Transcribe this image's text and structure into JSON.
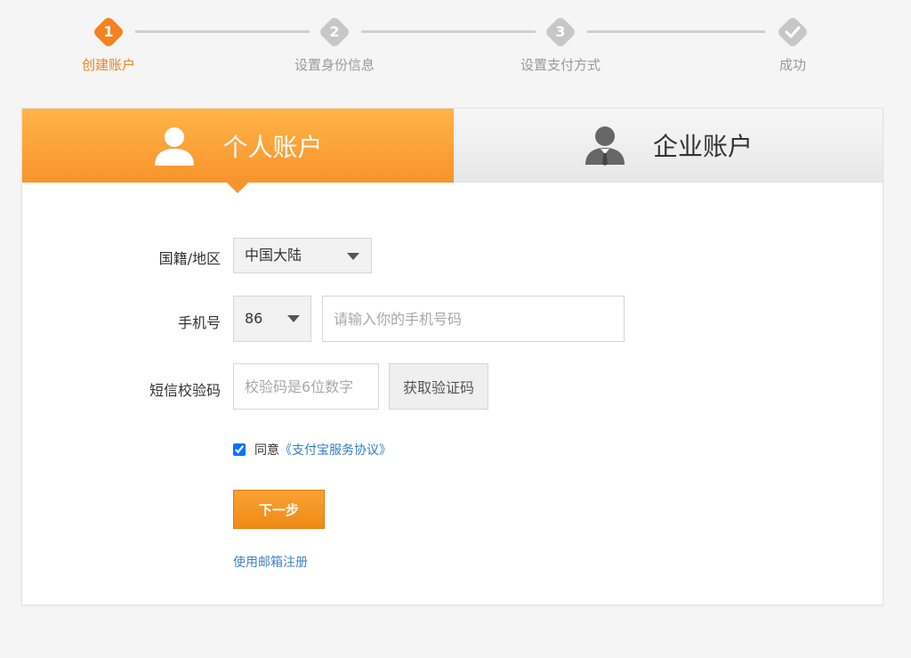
{
  "steps": [
    {
      "number": "1",
      "label": "创建账户",
      "state": "active"
    },
    {
      "number": "2",
      "label": "设置身份信息",
      "state": "pending"
    },
    {
      "number": "3",
      "label": "设置支付方式",
      "state": "pending"
    },
    {
      "number": "",
      "label": "成功",
      "state": "pending",
      "icon": "checkmark-icon"
    }
  ],
  "tabs": {
    "personal": {
      "label": "个人账户",
      "icon": "user-icon",
      "selected": true
    },
    "business": {
      "label": "企业账户",
      "icon": "business-user-icon",
      "selected": false
    }
  },
  "form": {
    "nationality": {
      "label": "国籍/地区",
      "value": "中国大陆"
    },
    "phone": {
      "label": "手机号",
      "country_code": "86",
      "placeholder": "请输入你的手机号码"
    },
    "sms": {
      "label": "短信校验码",
      "placeholder": "校验码是6位数字",
      "button_label": "获取验证码"
    },
    "agreement": {
      "prefix": "同意",
      "link_text": "《支付宝服务协议》",
      "checked": true
    },
    "next_button": "下一步",
    "email_register_link": "使用邮箱注册"
  },
  "colors": {
    "accent": "#f3821f",
    "link": "#2e7ec8",
    "inactive_step": "#c7c7c7"
  }
}
